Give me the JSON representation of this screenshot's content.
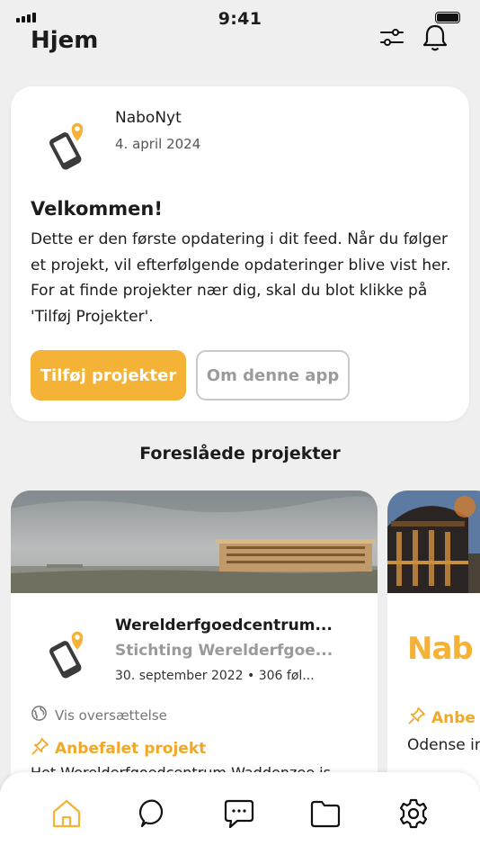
{
  "status": {
    "time": "9:41"
  },
  "header": {
    "title": "Hjem"
  },
  "welcome": {
    "app_name": "NaboNyt",
    "date": "4. april 2024",
    "heading": "Velkommen!",
    "body": "Dette er den første opdatering i dit feed. Når du følger et projekt, vil efterfølgende opdateringer blive vist her. For at finde projekter nær dig, skal du blot klikke på 'Tilføj Projekter'.",
    "primary_button": "Tilføj projekter",
    "secondary_button": "Om denne app"
  },
  "suggested": {
    "title": "Foreslåede projekter",
    "projects": [
      {
        "name": "Werelderfgoedcentrum...",
        "org": "Stichting Werelderfgoe...",
        "meta": "30. september 2022 • 306 føl...",
        "translate": "Vis oversættelse",
        "recommended": "Anbefalet projekt",
        "description": "Het Werelderfgoedcentrum Waddenzee is"
      },
      {
        "logo_text": "Nab",
        "recommended": "Anbe",
        "description": "Odense infrastru"
      }
    ]
  },
  "tabbar": {
    "items": [
      "home-icon",
      "search-icon",
      "messages-icon",
      "folder-icon",
      "settings-icon"
    ],
    "active": "home-icon"
  },
  "colors": {
    "accent": "#f4b236",
    "accent_text": "#f0a826"
  }
}
